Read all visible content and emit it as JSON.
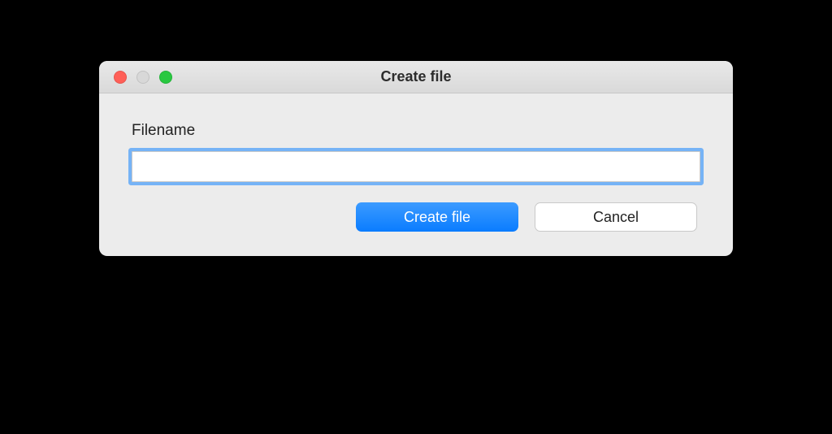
{
  "dialog": {
    "title": "Create file",
    "label": "Filename",
    "input_value": "",
    "input_placeholder": "",
    "buttons": {
      "primary": "Create file",
      "secondary": "Cancel"
    }
  }
}
